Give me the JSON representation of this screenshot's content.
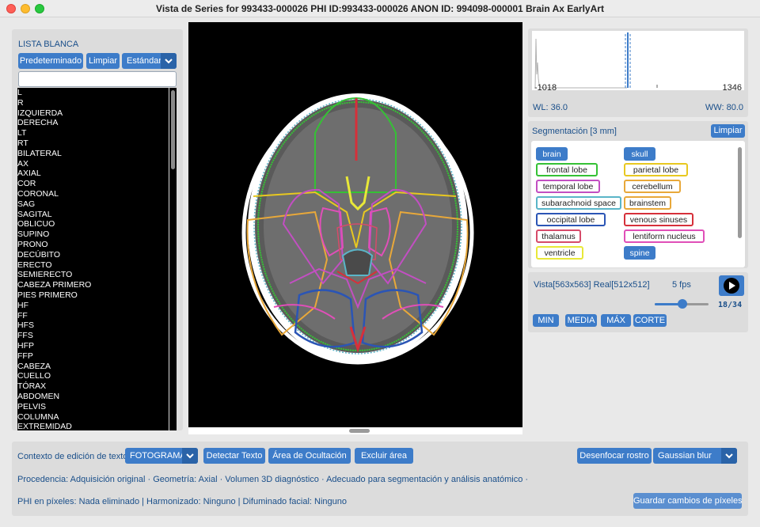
{
  "window": {
    "title": "Vista de Series for 993433-000026 PHI ID:993433-000026 ANON ID: 994098-000001 Brain Ax EarlyArt"
  },
  "whitelist": {
    "title": "LISTA BLANCA",
    "buttons": {
      "default": "Predeterminado",
      "clear": "Limpiar",
      "standard": "Estándar"
    },
    "search_value": "",
    "items": [
      "L",
      "R",
      "IZQUIERDA",
      "DERECHA",
      "LT",
      "RT",
      "BILATERAL",
      "AX",
      "AXIAL",
      "COR",
      "CORONAL",
      "SAG",
      "SAGITAL",
      "OBLICUO",
      "SUPINO",
      "PRONO",
      "DECÚBITO",
      "ERECTO",
      "SEMIERECTO",
      "CABEZA PRIMERO",
      "PIES PRIMERO",
      "HF",
      "FF",
      "HFS",
      "FFS",
      "HFP",
      "FFP",
      "CABEZA",
      "CUELLO",
      "TÓRAX",
      "ABDOMEN",
      "PELVIS",
      "COLUMNA",
      "EXTREMIDAD"
    ]
  },
  "histogram": {
    "min_label": "-1018",
    "max_label": "1346",
    "wl_label": "WL: 36.0",
    "ww_label": "WW: 80.0"
  },
  "segmentation": {
    "title": "Segmentación [3 mm]",
    "clear": "Limpiar",
    "tags": [
      {
        "label": "brain",
        "solid": true,
        "color": "#3d7cc9"
      },
      {
        "label": "skull",
        "solid": true,
        "color": "#3d7cc9"
      },
      {
        "label": "frontal lobe",
        "solid": false,
        "color": "#35c135"
      },
      {
        "label": "parietal lobe",
        "solid": false,
        "color": "#e8c820"
      },
      {
        "label": "temporal lobe",
        "solid": false,
        "color": "#c24fc2"
      },
      {
        "label": "cerebellum",
        "solid": false,
        "color": "#e8a83a"
      },
      {
        "label": "subarachnoid space",
        "solid": false,
        "color": "#5ab5c8"
      },
      {
        "label": "brainstem",
        "solid": false,
        "color": "#e8a83a"
      },
      {
        "label": "occipital lobe",
        "solid": false,
        "color": "#2b55b5"
      },
      {
        "label": "venous sinuses",
        "solid": false,
        "color": "#d6303a"
      },
      {
        "label": "thalamus",
        "solid": false,
        "color": "#d64b6a"
      },
      {
        "label": "lentiform nucleus",
        "solid": false,
        "color": "#e04fb8"
      },
      {
        "label": "ventricle",
        "solid": false,
        "color": "#e8e838"
      },
      {
        "label": "spine",
        "solid": true,
        "color": "#3d7cc9"
      }
    ]
  },
  "playback": {
    "view_info": "Vista[563x563] Real[512x512]",
    "fps": "5 fps",
    "frame": "18/34",
    "position": 0.515,
    "buttons": [
      "MIN",
      "MEDIA",
      "MÁX",
      "CORTE"
    ]
  },
  "bottom": {
    "context_label": "Contexto de edición de texto:",
    "context_value": "FOTOGRAMA",
    "detect_text": "Detectar Texto",
    "occlusion_area": "Área de Ocultación",
    "exclude_area": "Excluir área",
    "blur_face": "Desenfocar rostro",
    "blur_type": "Gaussian blur",
    "procedure": "Procedencia: Adquisición original · Geometría: Axial · Volumen 3D diagnóstico · Adecuado para segmentación y análisis anatómico ·",
    "phi": "PHI en píxeles: Nada eliminado | Harmonizado: Ninguno | Difuminado facial: Ninguno",
    "save": "Guardar cambios de píxeles"
  }
}
